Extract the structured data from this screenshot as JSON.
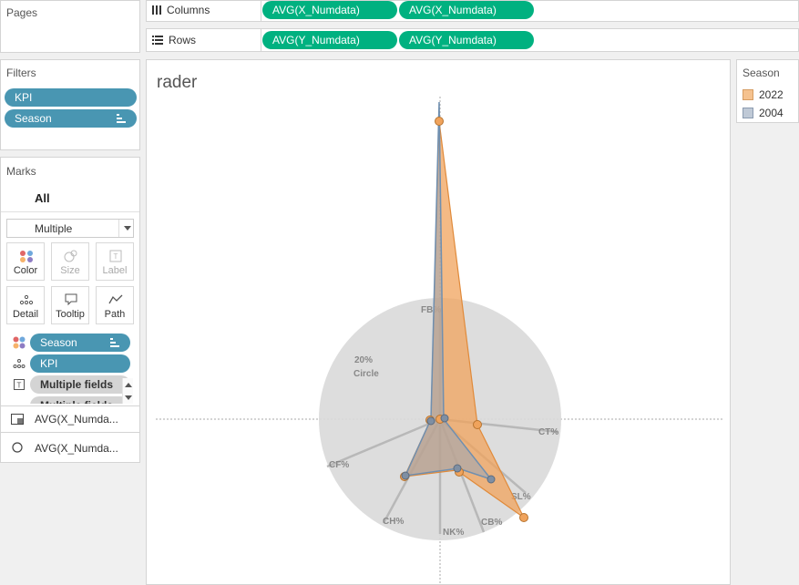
{
  "pages": {
    "title": "Pages"
  },
  "columns_shelf": {
    "label": "Columns",
    "pills": [
      "AVG(X_Numdata)",
      "AVG(X_Numdata)"
    ]
  },
  "rows_shelf": {
    "label": "Rows",
    "pills": [
      "AVG(Y_Numdata)",
      "AVG(Y_Numdata)"
    ]
  },
  "filters": {
    "title": "Filters",
    "items": [
      "KPI",
      "Season"
    ]
  },
  "marks": {
    "title": "Marks",
    "all_label": "All",
    "mark_type": "Multiple",
    "buttons": [
      "Color",
      "Size",
      "Label",
      "Detail",
      "Tooltip",
      "Path"
    ],
    "fields": [
      "Season",
      "KPI",
      "Multiple fields",
      "Multiple fields"
    ],
    "layers": [
      "AVG(X_Numda...",
      "AVG(X_Numda..."
    ]
  },
  "view": {
    "title": "rader",
    "circle_label_line1": "20%",
    "circle_label_line2": "Circle",
    "axes": [
      "FB%",
      "CT%",
      "SL%",
      "CB%",
      "NK%",
      "CH%",
      "CF%"
    ]
  },
  "legend": {
    "title": "Season",
    "items": [
      {
        "label": "2022",
        "color": "#f5c28f"
      },
      {
        "label": "2004",
        "color": "#bfc9d6"
      }
    ]
  },
  "colors": {
    "green_pill": "#00b180",
    "blue_pill": "#4996b2",
    "series_2022": "#f0a35c",
    "series_2004": "#6f8fb0",
    "circle_fill": "#d9d9d9"
  }
}
